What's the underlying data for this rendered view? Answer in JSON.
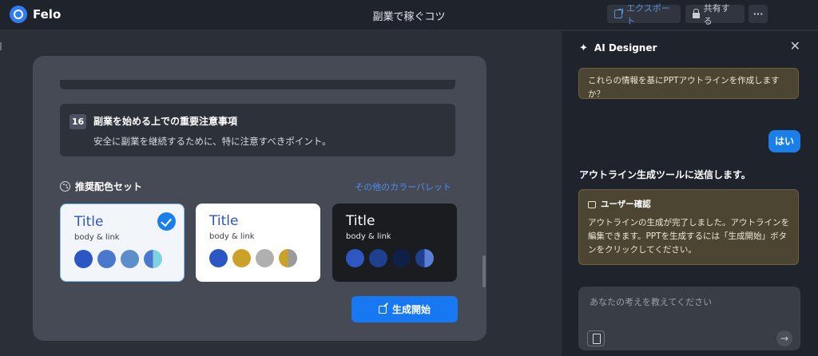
{
  "app": {
    "name": "Felo"
  },
  "header": {
    "title": "副業で稼ぐコツ",
    "export_label": "エクスポート",
    "share_label": "共有する",
    "more_label": "···"
  },
  "outline": {
    "item": {
      "number": "16",
      "title": "副業を始める上での重要注意事項",
      "description": "安全に副業を継続するために、特に注意すべきポイント。"
    }
  },
  "palettes": {
    "section_title": "推奨配色セット",
    "other_link": "その他のカラーパレット",
    "items": [
      {
        "title": "Title",
        "body": "body &  link",
        "selected": true,
        "colors": [
          "#2c56c4",
          "#4a78cf",
          "#5a8fcb",
          "#7fd3e0"
        ]
      },
      {
        "title": "Title",
        "body": "body &  link",
        "selected": false,
        "colors": [
          "#2c56c4",
          "#c9a227",
          "#b0b0b0",
          "#9a9a9a"
        ]
      },
      {
        "title": "Title",
        "body": "body &  link",
        "selected": false,
        "colors": [
          "#2f57c2",
          "#1f3f8f",
          "#0f1f45",
          "#5a7fd6"
        ]
      }
    ],
    "generate_label": "生成開始"
  },
  "ai_panel": {
    "title": "AI Designer",
    "close_label": "✕",
    "prev_message": "これらの情報を基にPPTアウトラインを作成しますか？",
    "user_message": "はい",
    "status_text": "アウトライン生成ツールに送信します。",
    "confirm_title": "ユーザー確認",
    "confirm_text": "アウトラインの生成が完了しました。アウトラインを編集できます。PPTを生成するには「生成開始」ボタンをクリックしてください。",
    "input_placeholder": "あなたの考えを教えてください",
    "send_label": "→"
  },
  "colors": {
    "accent": "#1778f2",
    "panel_bg": "#1f232b",
    "card_bg": "#454a54",
    "notice_bg": "#4b4531"
  }
}
